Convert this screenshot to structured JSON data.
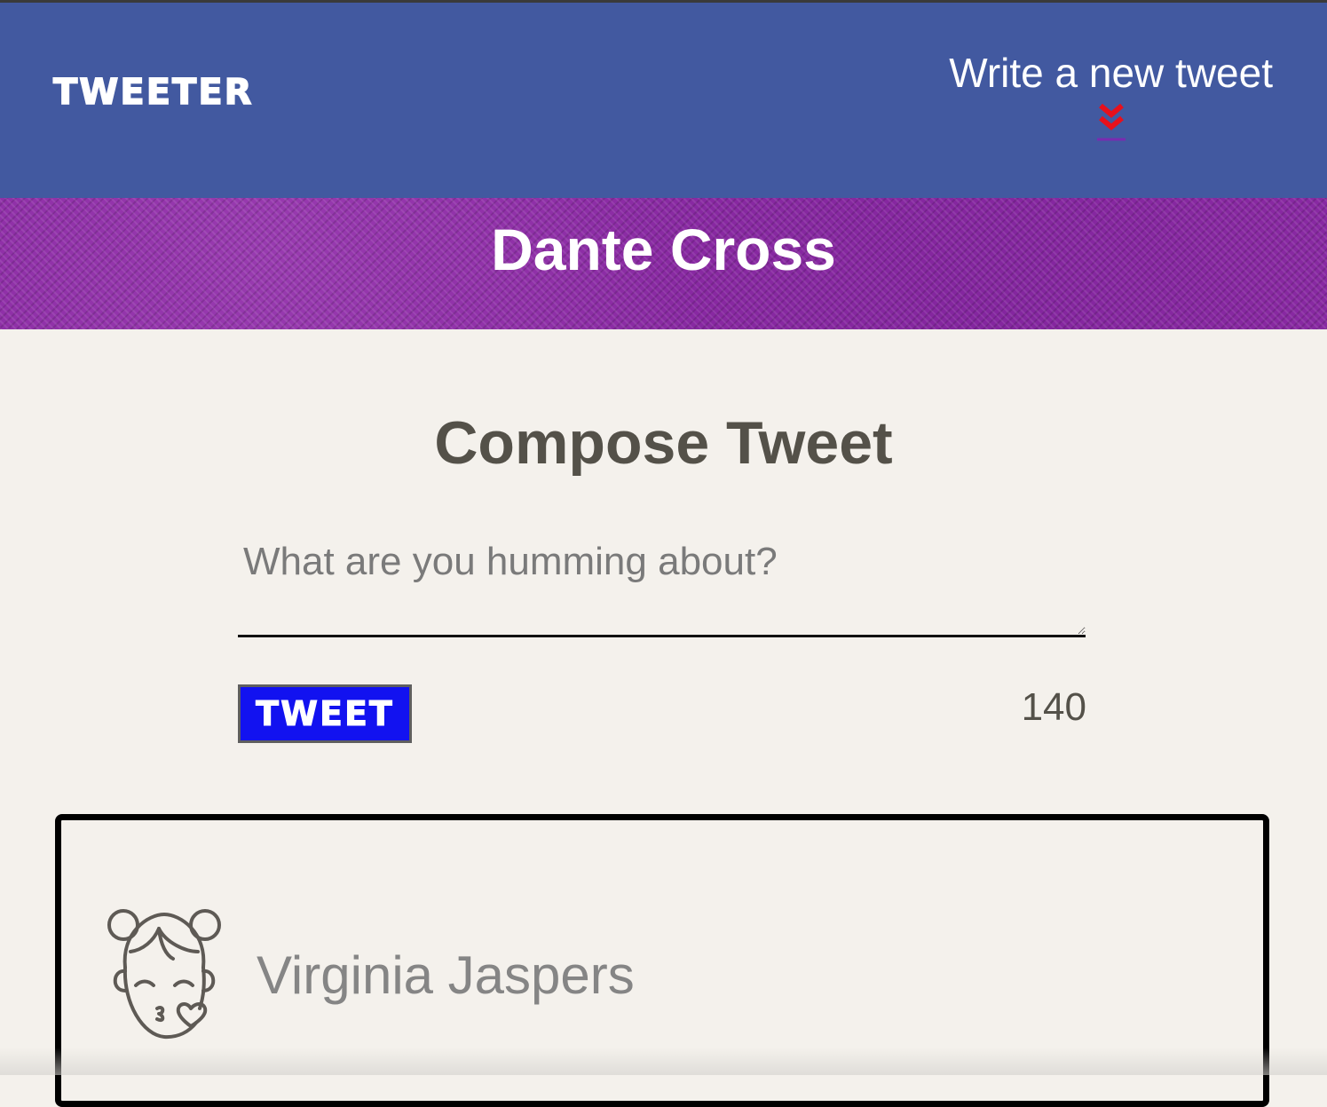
{
  "nav": {
    "logo": "TWEETER",
    "compose_link": "Write a new tweet",
    "compose_icon": "double-chevron-down-icon"
  },
  "profile": {
    "name": "Dante Cross"
  },
  "compose": {
    "title": "Compose Tweet",
    "placeholder": "What are you humming about?",
    "value": "",
    "button_label": "TWEET",
    "counter": "140"
  },
  "tweets": [
    {
      "author_name": "Virginia Jaspers",
      "avatar_icon": "kissing-girl-avatar-icon"
    }
  ],
  "colors": {
    "navbar": "#4259a0",
    "banner": "#8a2aa3",
    "background": "#f4f1ec",
    "tweet_button": "#1212f0",
    "chevron": "#e8101c",
    "text_dark": "#545149"
  }
}
